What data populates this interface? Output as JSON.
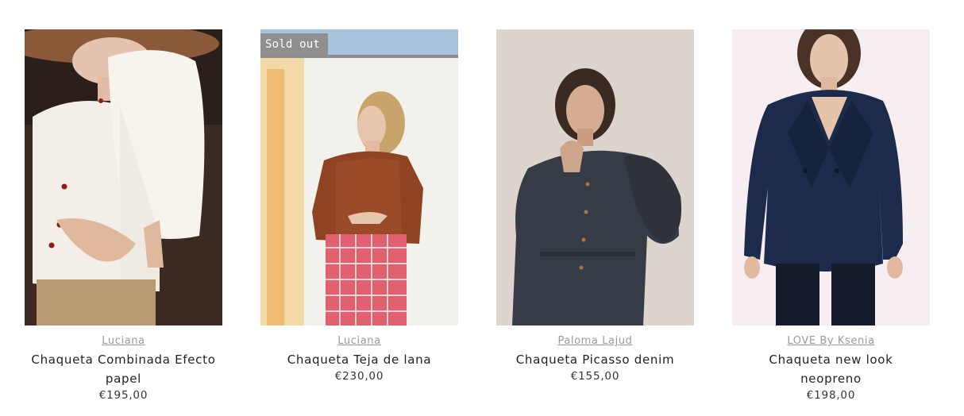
{
  "products": [
    {
      "vendor": "Luciana",
      "title": "Chaqueta Combinada Efecto papel",
      "price": "€195,00",
      "badge": ""
    },
    {
      "vendor": "Luciana",
      "title": "Chaqueta Teja de lana",
      "price": "€230,00",
      "badge": "Sold out"
    },
    {
      "vendor": "Paloma Lajud",
      "title": "Chaqueta Picasso denim",
      "price": "€155,00",
      "badge": ""
    },
    {
      "vendor": "LOVE By Ksenia",
      "title": "Chaqueta new look neopreno",
      "price": "€198,00",
      "badge": ""
    }
  ]
}
